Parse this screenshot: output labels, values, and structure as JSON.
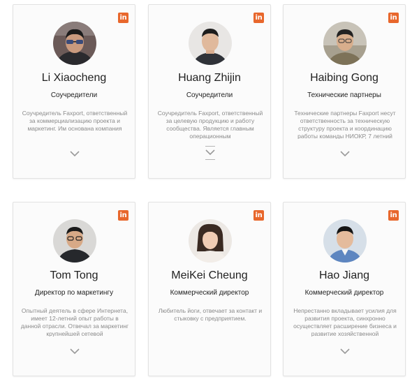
{
  "colors": {
    "linkedin_badge": "#e8672c",
    "card_border": "#e2e2e2",
    "description_text": "#8a8a8a"
  },
  "linkedin_badge_text": "in",
  "team": [
    {
      "name": "Li Xiaocheng",
      "role": "Соучредители",
      "description": "Соучредитель Faxport, ответственный за коммерциализацию проекта и маркетинг. Им основана компания",
      "icon": "chevron-down-icon"
    },
    {
      "name": "Huang Zhijin",
      "role": "Соучредители",
      "description": "Соучредитель Faxport, ответственный за целевую продукцию и работу сообщества. Является главным операционным",
      "icon": "chevron-down-icon"
    },
    {
      "name": "Haibing Gong",
      "role": "Технические партнеры",
      "description": "Технические партнеры Faxport несут ответственность за техническую структуру проекта и координацию работы команды НИОКР, 7 летний",
      "icon": "chevron-down-icon"
    },
    {
      "name": "Tom Tong",
      "role": "Директор по маркетингу",
      "description": "Опытный деятель в сфере Интернета, имеет 12-летний опыт работы в данной отрасли. Отвечал за маркетинг крупнейшей сетевой",
      "icon": "chevron-down-icon"
    },
    {
      "name": "MeiKei Cheung",
      "role": "Коммерческий директор",
      "description": "Любитель йоги, отвечает за контакт и стыковку с предприятием.",
      "icon": "chevron-down-icon"
    },
    {
      "name": "Hao Jiang",
      "role": "Коммерческий директор",
      "description": "Непрестанно вкладывает усилия для развития проекта, синхронно осуществляет расширение бизнеса и развитие хозяйственной",
      "icon": "chevron-down-icon"
    }
  ]
}
